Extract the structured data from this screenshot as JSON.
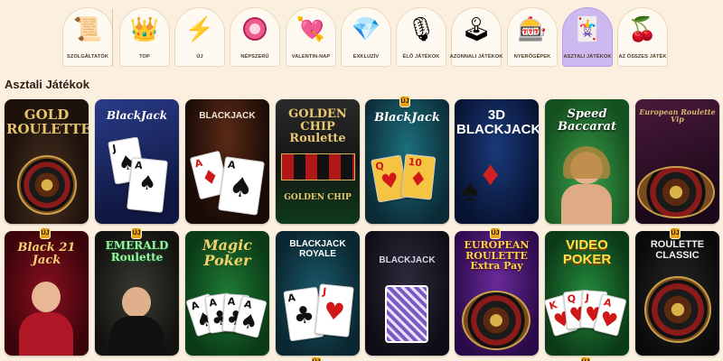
{
  "categories": [
    {
      "label": "SZOLGÁLTATÓK",
      "icon": "scroll-icon",
      "glyph": "📜"
    },
    {
      "label": "TOP",
      "icon": "crown-icon",
      "glyph": "👑"
    },
    {
      "label": "ÚJ",
      "icon": "lightning-icon",
      "glyph": "⚡"
    },
    {
      "label": "NÉPSZERŰ",
      "icon": "chip-icon",
      "glyph": "🎰"
    },
    {
      "label": "VALENTIN-NAP",
      "icon": "heart-icon",
      "glyph": "💘"
    },
    {
      "label": "EXKLUZÍV",
      "icon": "diamond-icon",
      "glyph": "💎"
    },
    {
      "label": "ÉLŐ JÁTÉKOK",
      "icon": "microphone-icon",
      "glyph": "🎙"
    },
    {
      "label": "AZONNALI JÁTÉKOK",
      "icon": "joystick-icon",
      "glyph": "🕹"
    },
    {
      "label": "NYERŐGÉPEK",
      "icon": "slot-machine-icon",
      "glyph": "🎰"
    },
    {
      "label": "ASZTALI JÁTÉKOK",
      "icon": "cards-icon",
      "glyph": "🃏"
    },
    {
      "label": "AZ ÖSSZES JÁTÉK",
      "icon": "cherry-icon",
      "glyph": "🍒"
    }
  ],
  "section_title": "Asztali Játékok",
  "new_badge": "ÚJ",
  "games": [
    {
      "title": "GOLD ROULETTE"
    },
    {
      "title": "BlackJack"
    },
    {
      "title": "BLACKJACK"
    },
    {
      "title": "GOLDEN CHIP Roulette"
    },
    {
      "title": "BlackJack"
    },
    {
      "title": "3D BLACKJACK"
    },
    {
      "title": "Speed Baccarat"
    },
    {
      "title": "European Roulette Vip"
    },
    {
      "title": "Black 21 Jack"
    },
    {
      "title": "EMERALD Roulette"
    },
    {
      "title": "Magic Poker"
    },
    {
      "title": "BLACKJACK ROYALE"
    },
    {
      "title": "BLACKJACK"
    },
    {
      "title": "EUROPEAN ROULETTE Extra Pay"
    },
    {
      "title": "VIDEO POKER"
    },
    {
      "title": "ROULETTE CLASSIC"
    }
  ],
  "golden_chip_sub": "GOLDEN CHIP"
}
